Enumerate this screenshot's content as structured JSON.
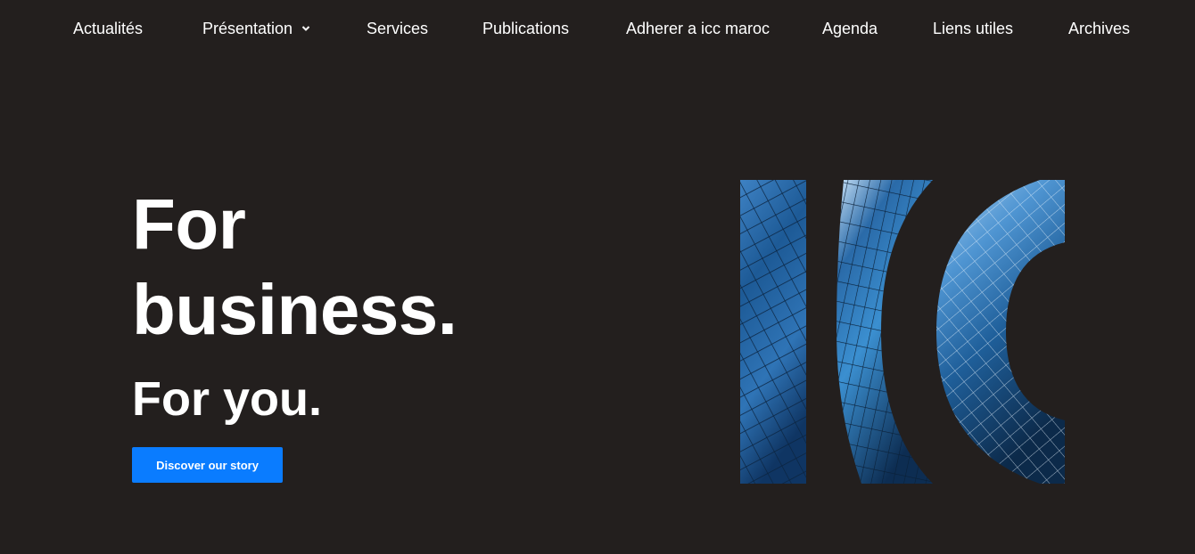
{
  "nav": {
    "items": [
      {
        "label": "Actualités"
      },
      {
        "label": "Présentation",
        "has_dropdown": true
      },
      {
        "label": "Services"
      },
      {
        "label": "Publications"
      },
      {
        "label": "Adherer a icc maroc"
      },
      {
        "label": "Agenda"
      },
      {
        "label": "Liens utiles"
      },
      {
        "label": "Archives"
      }
    ]
  },
  "hero": {
    "line1": "For",
    "line2": "business.",
    "line3": "For you.",
    "cta_label": "Discover our story"
  },
  "logo": {
    "icon": "icc-building-letters-icon"
  },
  "colors": {
    "background": "#231f1e",
    "text": "#ffffff",
    "accent": "#0a7cff",
    "logo_dark": "#0c2a4a",
    "logo_mid": "#1f5f9a",
    "logo_light": "#8fc3ee"
  }
}
